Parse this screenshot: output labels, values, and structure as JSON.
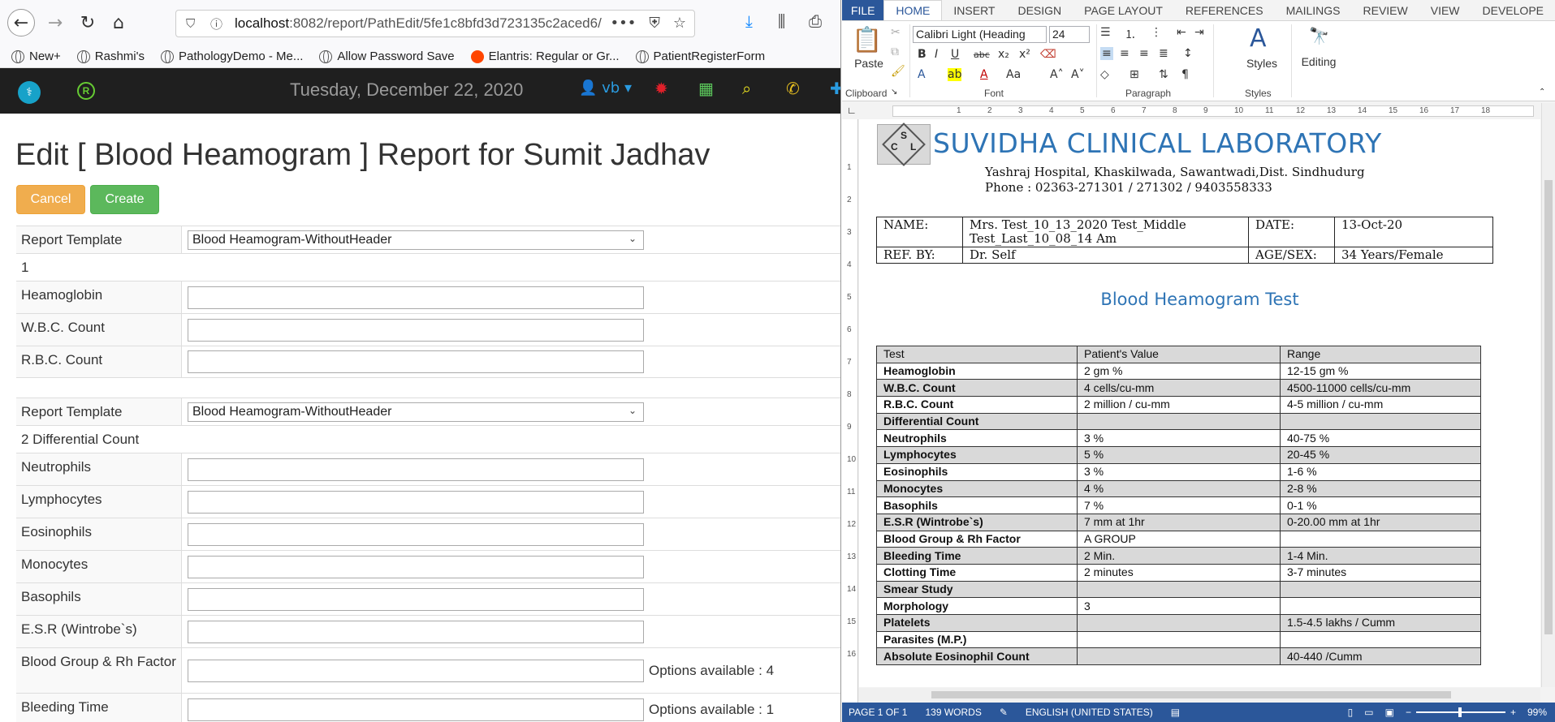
{
  "browser": {
    "url_host": "localhost",
    "url_rest": ":8082/report/PathEdit/5fe1c8bfd3d723135c2aced6/",
    "bookmarks": [
      "New+",
      "Rashmi's",
      "PathologyDemo - Me...",
      "Allow Password Save",
      "Elantris: Regular or Gr...",
      "PatientRegisterForm"
    ]
  },
  "app": {
    "date": "Tuesday, December 22, 2020",
    "user": "vb",
    "title": "Edit [ Blood Heamogram ] Report for Sumit Jadhav",
    "cancel_label": "Cancel",
    "create_label": "Create",
    "section1": {
      "template_label": "Report Template",
      "template_value": "Blood Heamogram-WithoutHeader",
      "heading": "1",
      "fields": [
        "Heamoglobin",
        "W.B.C. Count",
        "R.B.C. Count"
      ]
    },
    "section2": {
      "template_label": "Report Template",
      "template_value": "Blood Heamogram-WithoutHeader",
      "heading": "2 Differential Count",
      "fields": [
        "Neutrophils",
        "Lymphocytes",
        "Eosinophils",
        "Monocytes",
        "Basophils",
        "E.S.R (Wintrobe`s)"
      ],
      "blood_group_label": "Blood Group & Rh Factor",
      "blood_group_options": "Options available : 4",
      "bleeding_label": "Bleeding Time",
      "bleeding_options": "Options available : 1"
    }
  },
  "word": {
    "tabs": [
      "FILE",
      "HOME",
      "INSERT",
      "DESIGN",
      "PAGE LAYOUT",
      "REFERENCES",
      "MAILINGS",
      "REVIEW",
      "VIEW",
      "DEVELOPE"
    ],
    "font_name": "Calibri Light (Heading",
    "font_size": "24",
    "paste_label": "Paste",
    "styles_label": "Styles",
    "editing_label": "Editing",
    "groups": [
      "Clipboard",
      "Font",
      "Paragraph",
      "Styles"
    ],
    "status": {
      "page": "PAGE 1 OF 1",
      "words": "139 WORDS",
      "lang": "ENGLISH (UNITED STATES)",
      "zoom": "99%"
    },
    "doc": {
      "logo_letters": [
        "S",
        "C",
        "L"
      ],
      "lab_name": "SUVIDHA CLINICAL LABORATORY",
      "addr1": "Yashraj Hospital, Khaskilwada, Sawantwadi,Dist. Sindhudurg",
      "addr2": "Phone : 02363-271301 / 271302 / 9403558333",
      "name_label": "NAME:",
      "name_value_1": "Mrs. Test_10_13_2020 Test_Middle",
      "name_value_2": "Test_Last_10_08_14 Am",
      "date_label": "DATE:",
      "date_value": "13-Oct-20",
      "ref_label": "REF. BY:",
      "ref_value": "Dr. Self",
      "age_label": "AGE/SEX:",
      "age_value": "34 Years/Female",
      "title": "Blood Heamogram Test",
      "results": [
        [
          "Test",
          "Patient's Value",
          "Range",
          "hdr"
        ],
        [
          "Heamoglobin",
          "2 gm %",
          "12-15 gm %",
          ""
        ],
        [
          "W.B.C. Count",
          "4 cells/cu-mm",
          "4500-11000 cells/cu-mm",
          "shade"
        ],
        [
          "R.B.C. Count",
          "2 million / cu-mm",
          "4-5 million / cu-mm",
          ""
        ],
        [
          "Differential Count",
          "",
          "",
          "shade"
        ],
        [
          "Neutrophils",
          "3 %",
          "40-75 %",
          ""
        ],
        [
          "Lymphocytes",
          "5 %",
          "20-45 %",
          "shade"
        ],
        [
          "Eosinophils",
          "3 %",
          "1-6 %",
          ""
        ],
        [
          "Monocytes",
          "4 %",
          "2-8 %",
          "shade"
        ],
        [
          "Basophils",
          "7 %",
          "0-1 %",
          ""
        ],
        [
          "E.S.R (Wintrobe`s)",
          "7 mm at 1hr",
          "0-20.00 mm at 1hr",
          "shade"
        ],
        [
          "Blood  Group & Rh Factor",
          "A  GROUP",
          "",
          ""
        ],
        [
          "Bleeding Time",
          "2 Min.",
          "1-4 Min.",
          "shade"
        ],
        [
          "Clotting Time",
          "2 minutes",
          "3-7 minutes",
          ""
        ],
        [
          "Smear Study",
          "",
          "",
          "shade"
        ],
        [
          "Morphology",
          "3",
          "",
          ""
        ],
        [
          "Platelets",
          "",
          "1.5-4.5 lakhs / Cumm",
          "shade"
        ],
        [
          "Parasites (M.P.)",
          "",
          "",
          ""
        ],
        [
          "Absolute Eosinophil Count",
          "",
          "40-440 /Cumm",
          "shade"
        ]
      ]
    }
  }
}
